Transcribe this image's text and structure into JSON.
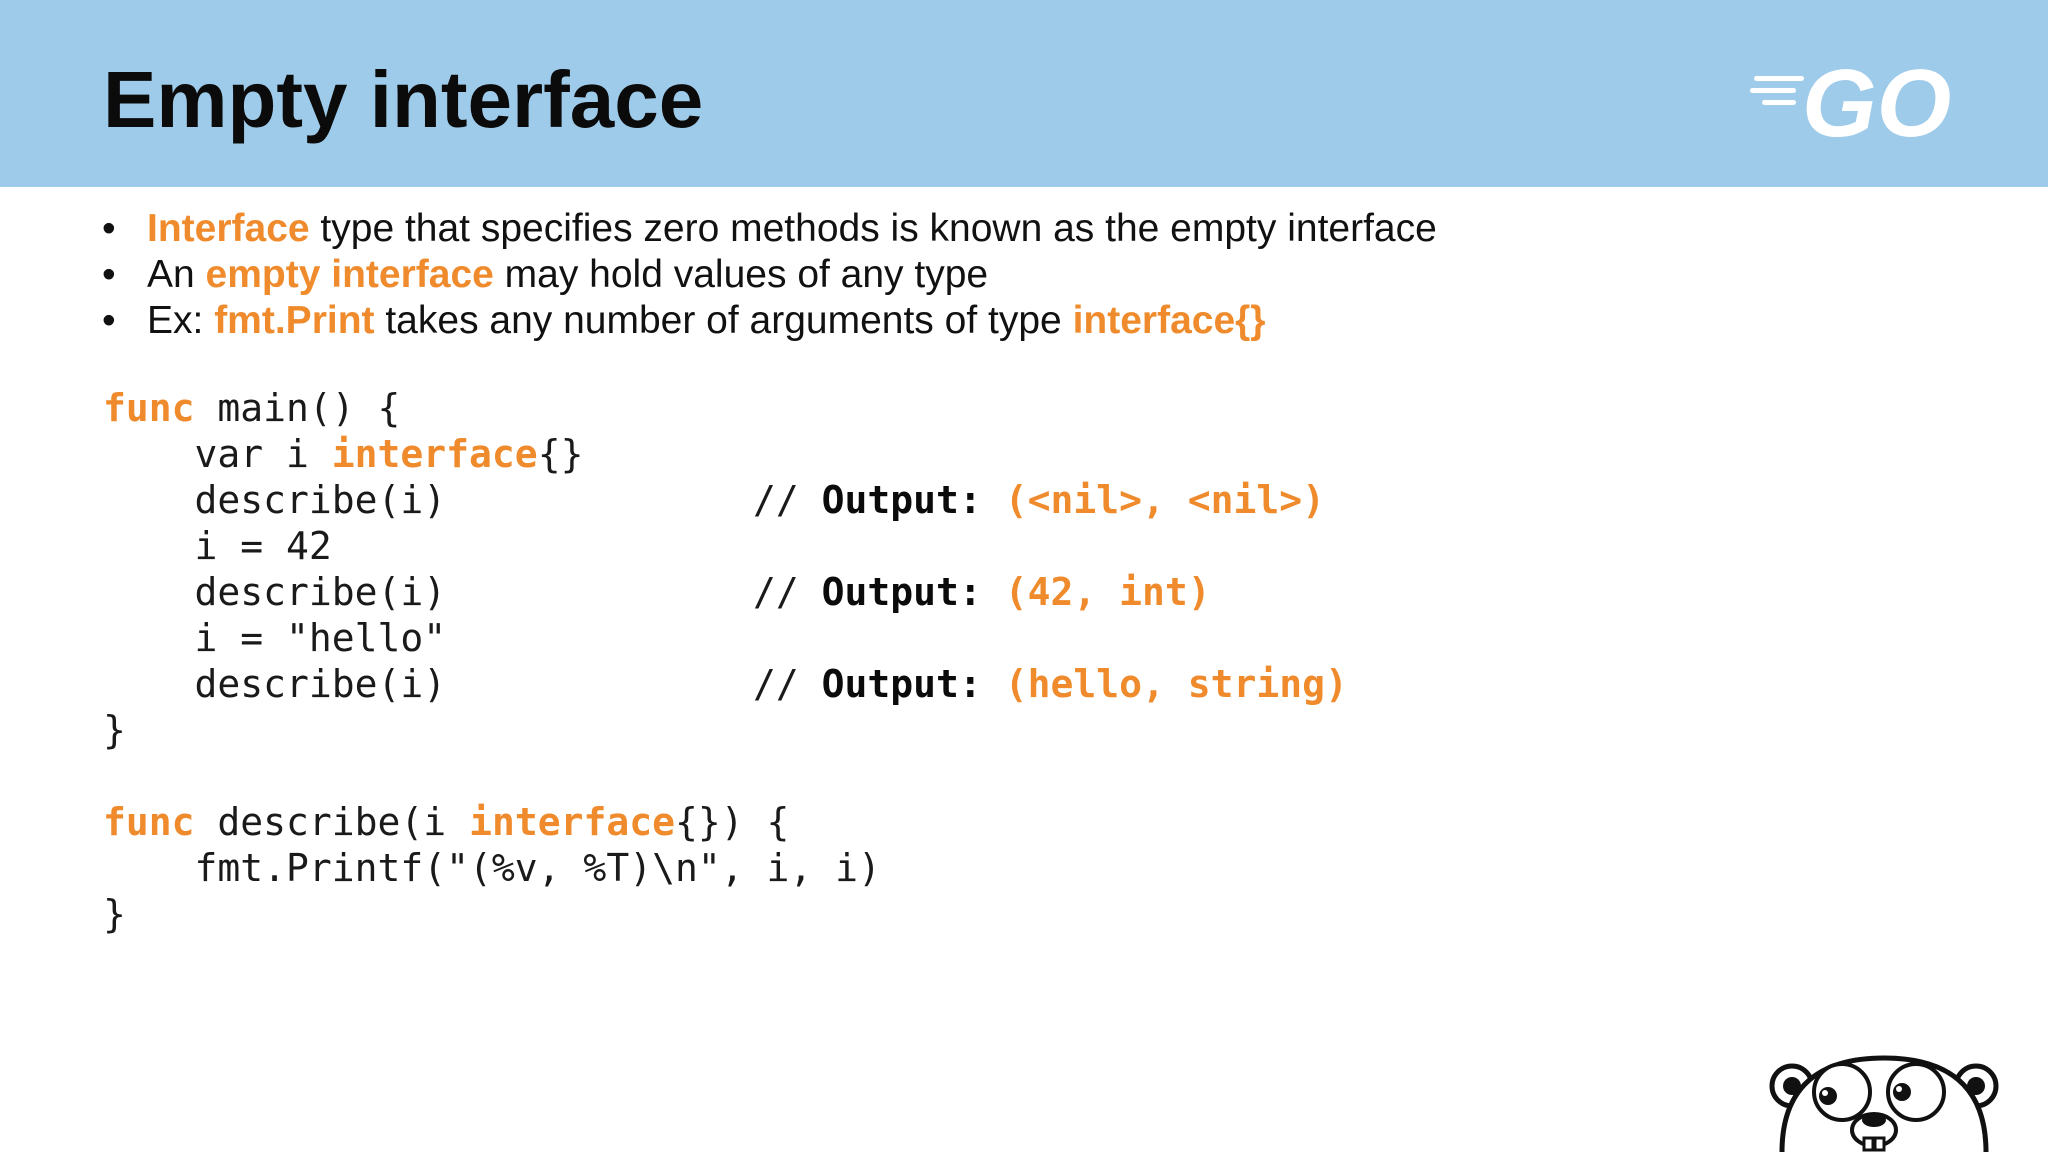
{
  "slide": {
    "title": "Empty interface"
  },
  "bullets": [
    {
      "pre": "",
      "hl": "Interface",
      "post": " type that specifies zero methods is known as the empty interface"
    },
    {
      "pre": "An ",
      "hl": "empty interface",
      "post": " may hold values of any type"
    },
    {
      "pre": "Ex: ",
      "hl": "fmt.Print",
      "mid": " takes any number of arguments of type ",
      "hl2": "interface{}"
    }
  ],
  "code": {
    "l1_kw": "func",
    "l1_rest": " main() {",
    "l2_pre": "    var i ",
    "l2_kw": "interface",
    "l2_post": "{}",
    "l3": "    describe(i)",
    "l4": "    i = 42",
    "l5": "    describe(i)",
    "l6": "    i = \"hello\"",
    "l7": "    describe(i)",
    "l8": "}",
    "l10_kw": "func",
    "l10_mid": " describe(i ",
    "l10_kw2": "interface",
    "l10_post": "{}) {",
    "l11": "    fmt.Printf(\"(%v, %T)\\n\", i, i)",
    "l12": "}",
    "comment_prefix": "// ",
    "output_label": "Output:",
    "outputs": [
      "(<nil>, <nil>)",
      "(42, int)",
      "(hello, string)"
    ]
  },
  "colors": {
    "header_bg": "#9fcbea",
    "accent": "#ef8b2c",
    "text": "#111111"
  },
  "logo": {
    "text": "GO",
    "icon": "go-logo-icon"
  },
  "mascot": {
    "icon": "gopher-mascot-icon"
  }
}
